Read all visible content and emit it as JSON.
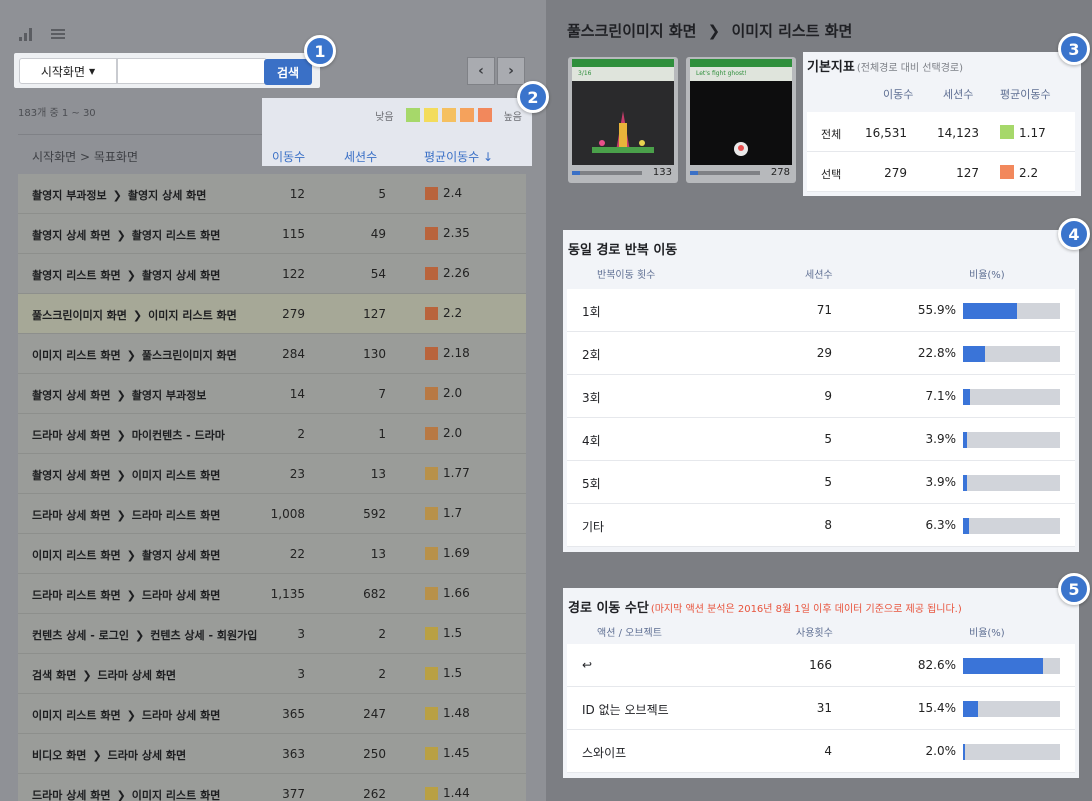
{
  "toolbar": {
    "signal_icon": "signal-bars-icon",
    "menu_icon": "hamburger-menu-icon"
  },
  "search": {
    "select_value": "시작화면",
    "input_value": "",
    "button_label": "검색"
  },
  "pager": {
    "prev": "‹",
    "next": "›"
  },
  "result_count": "183개 중 1 ~ 30",
  "legend": {
    "low": "낮음",
    "high": "높음",
    "colors": [
      "#a6d86a",
      "#f3dc5c",
      "#f5c060",
      "#f5a25c",
      "#f2885c"
    ]
  },
  "table": {
    "headers": {
      "path": "시작화면 > 목표화면",
      "moves": "이동수",
      "sessions": "세션수",
      "avg": "평균이동수 ↓"
    },
    "rows": [
      {
        "from": "촬영지 부과정보",
        "to": "촬영지 상세 화면",
        "moves": "12",
        "sessions": "5",
        "avg": "2.4",
        "color": "#b9643c"
      },
      {
        "from": "촬영지 상세 화면",
        "to": "촬영지 리스트 화면",
        "moves": "115",
        "sessions": "49",
        "avg": "2.35",
        "color": "#b9643c"
      },
      {
        "from": "촬영지 리스트 화면",
        "to": "촬영지 상세 화면",
        "moves": "122",
        "sessions": "54",
        "avg": "2.26",
        "color": "#b9643c"
      },
      {
        "from": "풀스크린이미지 화면",
        "to": "이미지 리스트 화면",
        "moves": "279",
        "sessions": "127",
        "avg": "2.2",
        "color": "#b9643c",
        "highlight": true
      },
      {
        "from": "이미지 리스트 화면",
        "to": "풀스크린이미지 화면",
        "moves": "284",
        "sessions": "130",
        "avg": "2.18",
        "color": "#b9643c"
      },
      {
        "from": "촬영지 상세 화면",
        "to": "촬영지 부과정보",
        "moves": "14",
        "sessions": "7",
        "avg": "2.0",
        "color": "#b87944"
      },
      {
        "from": "드라마 상세 화면",
        "to": "마이컨텐츠 - 드라마",
        "moves": "2",
        "sessions": "1",
        "avg": "2.0",
        "color": "#b87944"
      },
      {
        "from": "촬영지 상세 화면",
        "to": "이미지 리스트 화면",
        "moves": "23",
        "sessions": "13",
        "avg": "1.77",
        "color": "#b8914a"
      },
      {
        "from": "드라마 상세 화면",
        "to": "드라마 리스트 화면",
        "moves": "1,008",
        "sessions": "592",
        "avg": "1.7",
        "color": "#b8914a"
      },
      {
        "from": "이미지 리스트 화면",
        "to": "촬영지 상세 화면",
        "moves": "22",
        "sessions": "13",
        "avg": "1.69",
        "color": "#b8914a"
      },
      {
        "from": "드라마 리스트 화면",
        "to": "드라마 상세 화면",
        "moves": "1,135",
        "sessions": "682",
        "avg": "1.66",
        "color": "#b8914a"
      },
      {
        "from": "컨텐츠 상세 - 로그인",
        "to": "컨텐츠 상세 - 회원가입",
        "moves": "3",
        "sessions": "2",
        "avg": "1.5",
        "color": "#b9a044"
      },
      {
        "from": "검색 화면",
        "to": "드라마 상세 화면",
        "moves": "3",
        "sessions": "2",
        "avg": "1.5",
        "color": "#b9a044"
      },
      {
        "from": "이미지 리스트 화면",
        "to": "드라마 상세 화면",
        "moves": "365",
        "sessions": "247",
        "avg": "1.48",
        "color": "#b9a044"
      },
      {
        "from": "비디오 화면",
        "to": "드라마 상세 화면",
        "moves": "363",
        "sessions": "250",
        "avg": "1.45",
        "color": "#b9a044"
      },
      {
        "from": "드라마 상세 화면",
        "to": "이미지 리스트 화면",
        "moves": "377",
        "sessions": "262",
        "avg": "1.44",
        "color": "#b9a044"
      }
    ]
  },
  "detail": {
    "breadcrumb_from": "풀스크린이미지 화면",
    "breadcrumb_sep": "❯",
    "breadcrumb_to": "이미지 리스트 화면",
    "thumbs": [
      {
        "caption": "3/16",
        "count": "133"
      },
      {
        "caption": "Let's fight ghost!",
        "count": "278"
      }
    ]
  },
  "basic": {
    "title": "기본지표",
    "subtitle": "(전체경로 대비 선택경로)",
    "cols": [
      "이동수",
      "세션수",
      "평균이동수"
    ],
    "rows": [
      {
        "label": "전체",
        "moves": "16,531",
        "sessions": "14,123",
        "avg": "1.17",
        "color": "#a6d86a"
      },
      {
        "label": "선택",
        "moves": "279",
        "sessions": "127",
        "avg": "2.2",
        "color": "#f2885c"
      }
    ]
  },
  "repeat": {
    "title": "동일 경로 반복 이동",
    "cols": [
      "반복이동 횟수",
      "세션수",
      "비율(%)"
    ],
    "rows": [
      {
        "label": "1회",
        "value": "71",
        "pct": "55.9%",
        "ratio": 0.559
      },
      {
        "label": "2회",
        "value": "29",
        "pct": "22.8%",
        "ratio": 0.228
      },
      {
        "label": "3회",
        "value": "9",
        "pct": "7.1%",
        "ratio": 0.071
      },
      {
        "label": "4회",
        "value": "5",
        "pct": "3.9%",
        "ratio": 0.039
      },
      {
        "label": "5회",
        "value": "5",
        "pct": "3.9%",
        "ratio": 0.039
      },
      {
        "label": "기타",
        "value": "8",
        "pct": "6.3%",
        "ratio": 0.063
      }
    ]
  },
  "means": {
    "title": "경로 이동 수단",
    "note": "(마지막 액션 분석은 2016년 8월 1일 이후 데이터 기준으로 제공 됩니다.)",
    "cols": [
      "액션 / 오브젝트",
      "사용횟수",
      "비율(%)"
    ],
    "rows": [
      {
        "label": "↩",
        "value": "166",
        "pct": "82.6%",
        "ratio": 0.826
      },
      {
        "label": "ID 없는 오브젝트",
        "value": "31",
        "pct": "15.4%",
        "ratio": 0.154
      },
      {
        "label": "스와이프",
        "value": "4",
        "pct": "2.0%",
        "ratio": 0.02
      }
    ]
  },
  "badges": [
    "1",
    "2",
    "3",
    "4",
    "5"
  ]
}
